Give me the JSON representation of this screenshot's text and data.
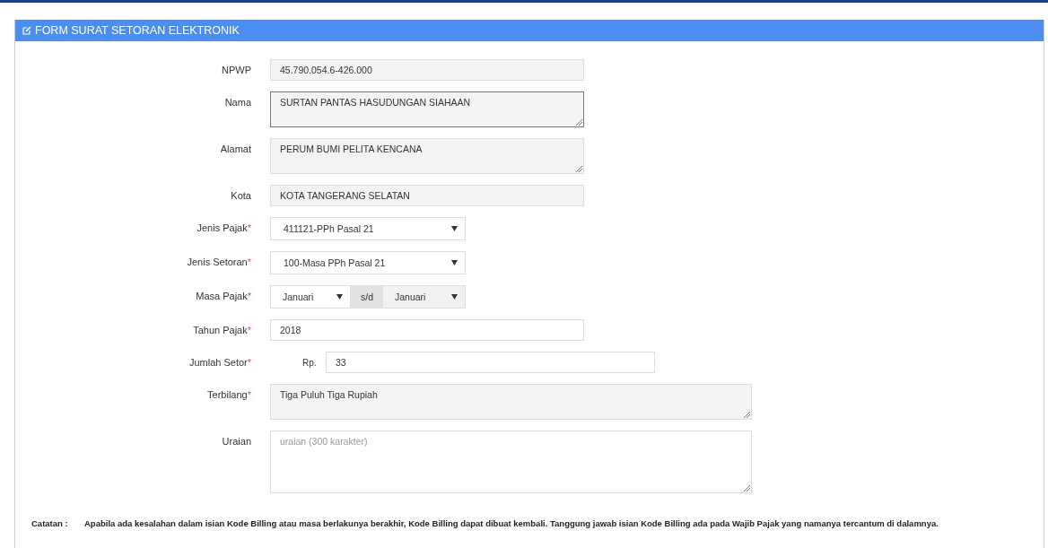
{
  "panel": {
    "title": "FORM SURAT SETORAN ELEKTRONIK"
  },
  "fields": [
    {
      "label": "NPWP",
      "kind": "text",
      "readonly": true,
      "value": "45.790.054.6-426.000"
    },
    {
      "label": "Nama",
      "kind": "textarea",
      "readonly": true,
      "value": "SURTAN PANTAS HASUDUNGAN SIAHAAN"
    },
    {
      "label": "Alamat",
      "kind": "textarea",
      "readonly": true,
      "value": "PERUM BUMI PELITA KENCANA"
    },
    {
      "label": "Kota",
      "kind": "text",
      "readonly": true,
      "value": "KOTA TANGERANG SELATAN"
    },
    {
      "label": "Jenis Pajak",
      "mark": "*",
      "kind": "select",
      "value": "411121-PPh Pasal 21"
    },
    {
      "label": "Jenis Setoran",
      "mark": "*",
      "kind": "select",
      "value": "100-Masa PPh Pasal 21"
    },
    {
      "label": "Masa Pajak",
      "mark": "*",
      "kind": "range",
      "from": "Januari",
      "separator": "s/d",
      "to": "Januari"
    },
    {
      "label": "Tahun Pajak",
      "mark": "*",
      "kind": "text",
      "readonly": false,
      "value": "2018"
    },
    {
      "label": "Jumlah Setor",
      "mark": "*",
      "kind": "currency",
      "prefix": "Rp.",
      "value": "33"
    },
    {
      "label": "Terbilang",
      "mark": "*",
      "kind": "wide-textarea",
      "readonly": true,
      "value": "Tiga Puluh Tiga Rupiah"
    },
    {
      "label": "Uraian",
      "kind": "tall-textarea",
      "readonly": false,
      "placeholder": "uraian (300 karakter)"
    }
  ],
  "note": {
    "label": "Catatan :",
    "text": "Apabila ada kesalahan dalam isian Kode Billing atau masa berlakunya berakhir, Kode Billing dapat dibuat kembali. Tanggung jawab isian Kode Billing ada pada Wajib Pajak yang namanya tercantum di dalamnya."
  }
}
